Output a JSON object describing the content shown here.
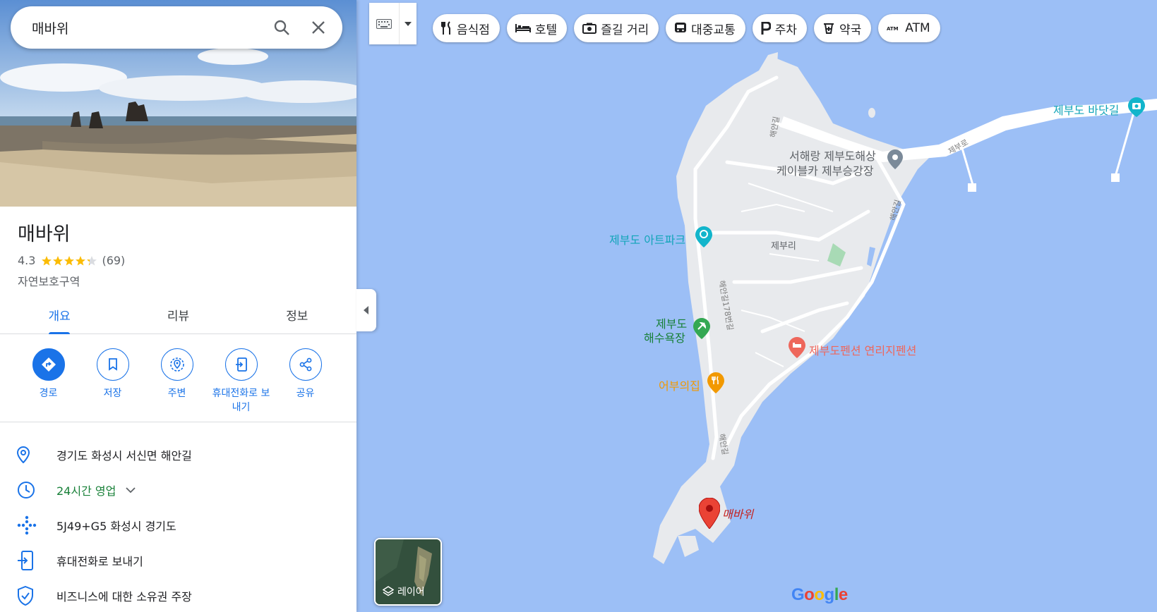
{
  "search": {
    "query": "매바위"
  },
  "place": {
    "title": "매바위",
    "rating": "4.3",
    "stars": 4.3,
    "review_count": "(69)",
    "category": "자연보호구역"
  },
  "tabs": [
    {
      "label": "개요",
      "active": true
    },
    {
      "label": "리뷰",
      "active": false
    },
    {
      "label": "정보",
      "active": false
    }
  ],
  "actions": [
    {
      "label": "경로",
      "icon": "directions-icon"
    },
    {
      "label": "저장",
      "icon": "bookmark-icon"
    },
    {
      "label": "주변",
      "icon": "nearby-icon"
    },
    {
      "label": "휴대전화로 보내기",
      "icon": "send-to-phone-icon"
    },
    {
      "label": "공유",
      "icon": "share-icon"
    }
  ],
  "info": [
    {
      "text": "경기도 화성시 서신면 해안길",
      "icon": "location-pin-icon"
    },
    {
      "text": "24시간 영업",
      "icon": "clock-icon"
    },
    {
      "text": "5J49+G5 화성시 경기도",
      "icon": "plus-code-icon"
    },
    {
      "text": "휴대전화로 보내기",
      "icon": "send-to-phone-icon"
    },
    {
      "text": "비즈니스에 대한 소유권 주장",
      "icon": "shield-check-icon"
    }
  ],
  "chips": [
    {
      "label": "음식점",
      "icon": "restaurant-icon"
    },
    {
      "label": "호텔",
      "icon": "hotel-icon"
    },
    {
      "label": "즐길 거리",
      "icon": "camera-icon"
    },
    {
      "label": "대중교통",
      "icon": "transit-icon"
    },
    {
      "label": "주차",
      "icon": "parking-icon"
    },
    {
      "label": "약국",
      "icon": "pharmacy-icon"
    },
    {
      "label": "ATM",
      "icon": "atm-icon"
    }
  ],
  "map": {
    "labels": {
      "badatgil": "제부도 바닷길",
      "cable_line1": "서해랑 제부도해상",
      "cable_line2": "케이블카 제부승강장",
      "jeburi": "제부리",
      "artpark": "제부도 아트파크",
      "beach_line1": "제부도",
      "beach_line2": "해수욕장",
      "pension": "제부도펜션 연리지펜션",
      "restaurant": "어부의집",
      "maebawi": "매바위"
    },
    "roads": {
      "haean_top": "해안길",
      "haean_right": "해안길",
      "haean_178": "해안길178번길",
      "haean_bottom": "해안길",
      "jebu_ro": "제부로"
    },
    "layer_label": "레이어",
    "google": "Google"
  },
  "colors": {
    "accent": "#1a73e8",
    "water": "#9cbff6",
    "land": "#e8eaed",
    "open_green": "#188038",
    "pin_red": "#ea4335",
    "teal_poi": "#12b5cb",
    "beach_green": "#34a853",
    "pension_pink": "#ee675c",
    "restaurant_orange": "#f29900"
  }
}
